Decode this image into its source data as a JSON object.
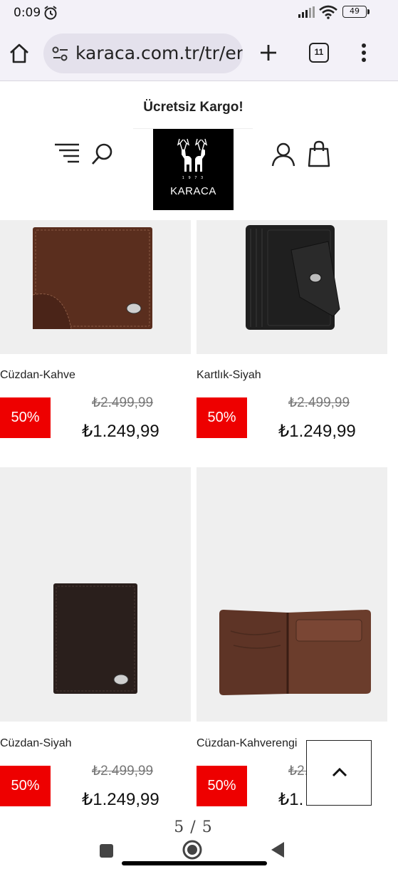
{
  "status_bar": {
    "time": "0:09",
    "battery": "49"
  },
  "browser": {
    "url": "karaca.com.tr/tr/erke",
    "tab_count": "11"
  },
  "site": {
    "promo": "Ücretsiz Kargo!",
    "logo_text": "KARACA"
  },
  "products": [
    {
      "name": "Cüzdan-Kahve",
      "discount": "50%",
      "old_price": "₺2.499,99",
      "new_price": "₺1.249,99"
    },
    {
      "name": "Kartlık-Siyah",
      "discount": "50%",
      "old_price": "₺2.499,99",
      "new_price": "₺1.249,99"
    },
    {
      "name": "Cüzdan-Siyah",
      "discount": "50%",
      "old_price": "₺2.499,99",
      "new_price": "₺1.249,99"
    },
    {
      "name": "Cüzdan-Kahverengi",
      "discount": "50%",
      "old_price": "₺2.",
      "new_price": "₺1."
    }
  ],
  "page_indicator": "5 / 5",
  "colors": {
    "discount": "#ee0000",
    "chrome_bg": "#f3f1f8",
    "image_bg": "#efefef"
  }
}
